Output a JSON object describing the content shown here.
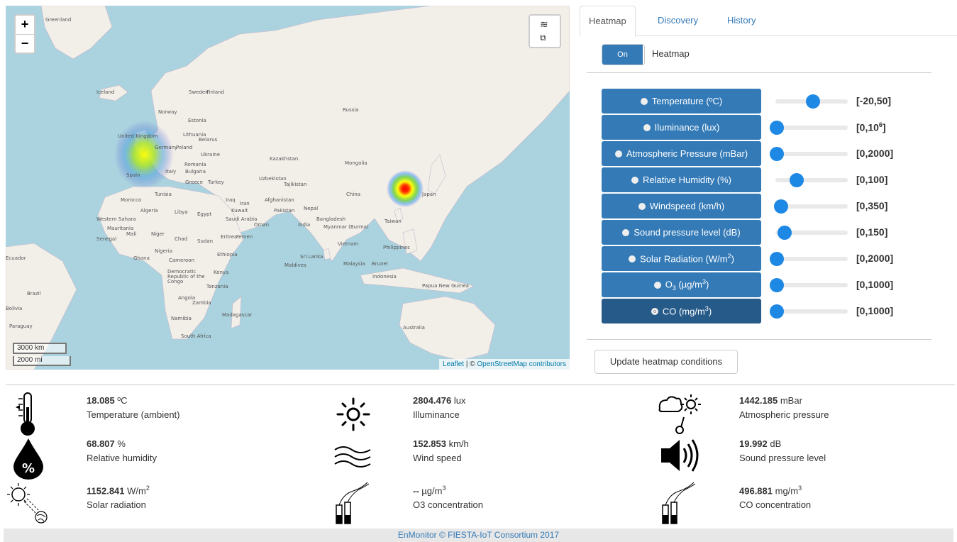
{
  "map": {
    "zoom_in": "+",
    "zoom_out": "−",
    "layers_icon": "layers-icon",
    "scale_km": "3000 km",
    "scale_mi": "2000 mi",
    "attribution_leaflet": "Leaflet",
    "attribution_sep": " | © ",
    "attribution_osm": "OpenStreetMap contributors",
    "labels": [
      "Greenland",
      "Iceland",
      "Sweden",
      "Finland",
      "Norway",
      "Estonia",
      "Lithuania",
      "Belarus",
      "Poland",
      "Germany",
      "Ukraine",
      "Romania",
      "Bulgaria",
      "Italy",
      "Spain",
      "Greece",
      "Turkey",
      "Tunisia",
      "Morocco",
      "Algeria",
      "Libya",
      "Egypt",
      "Western Sahara",
      "Mauritania",
      "Mali",
      "Niger",
      "Chad",
      "Sudan",
      "Senegal",
      "Nigeria",
      "Ghana",
      "Cameroon",
      "Ethiopia",
      "Eritrea",
      "Yemen",
      "Saudi Arabia",
      "Oman",
      "Iraq",
      "Iran",
      "Kuwait",
      "Afghanistan",
      "Pakistan",
      "India",
      "Nepal",
      "Bangladesh",
      "Myanmar (Burma)",
      "Sri Lanka",
      "Maldives",
      "Russia",
      "Kazakhstan",
      "Uzbekistan",
      "Tajikistan",
      "Mongolia",
      "China",
      "Japan",
      "Taiwan",
      "Philippines",
      "Vietnam",
      "Malaysia",
      "Brunei",
      "Indonesia",
      "Papua New Guinea",
      "Australia",
      "Tanzania",
      "Angola",
      "Zambia",
      "Namibia",
      "Madagascar",
      "South Africa",
      "Democratic Republic of the Congo",
      "Kenya",
      "Brazil",
      "Paraguay",
      "Bolivia",
      "Ecuador",
      "United Kingdom"
    ]
  },
  "tabs": [
    {
      "label": "Heatmap"
    },
    {
      "label": "Discovery"
    },
    {
      "label": "History"
    }
  ],
  "heatmap_toggle": {
    "state": "On",
    "label": "Heatmap"
  },
  "sensors": [
    {
      "name": "Temperature (ºC)",
      "range": "[-20,50]",
      "level": 0.55
    },
    {
      "name": "Iluminance (lux)",
      "range_main": "[0,10",
      "range_sup": "6",
      "range_end": "]",
      "level": 0.0
    },
    {
      "name": "Atmospheric Pressure (mBar)",
      "range": "[0,2000]",
      "level": 0.0
    },
    {
      "name": "Relative Humidity (%)",
      "range": "[0,100]",
      "level": 0.3
    },
    {
      "name": "Windspeed (km/h)",
      "range": "[0,350]",
      "level": 0.07
    },
    {
      "name_main": "Sound pressure level (dB)",
      "range": "[0,150]",
      "level": 0.12
    },
    {
      "name_main": "Solar Radiation (W/m",
      "name_sup": "2",
      "name_end": ")",
      "range": "[0,2000]",
      "level": 0.0
    },
    {
      "name_main": "O",
      "name_sub": "3",
      "name_mid": " (µg/m",
      "name_sup": "3",
      "name_end": ")",
      "range": "[0,1000]",
      "level": 0.0
    },
    {
      "name_main": "CO (mg/m",
      "name_sup": "3",
      "name_end": ")",
      "range": "[0,1000]",
      "level": 0.0
    }
  ],
  "update_button": "Update heatmap conditions",
  "readings": [
    {
      "value": "18.085",
      "unit": " ºC",
      "label": "Temperature (ambient)",
      "icon": "thermometer-icon"
    },
    {
      "value": "2804.476",
      "unit": " lux",
      "label": "Illuminance",
      "icon": "sun-icon"
    },
    {
      "value": "1442.185",
      "unit": " mBar",
      "label": "Atmospheric pressure",
      "icon": "barometer-icon"
    },
    {
      "value": "68.807",
      "unit": " %",
      "label": "Relative humidity",
      "icon": "humidity-drop-icon"
    },
    {
      "value": "152.853",
      "unit": " km/h",
      "label": "Wind speed",
      "icon": "wind-icon"
    },
    {
      "value": "19.992",
      "unit": " dB",
      "label": "Sound pressure level",
      "icon": "speaker-icon"
    },
    {
      "value": "1152.841",
      "unit": " W/m",
      "unit_sup": "2",
      "label": "Solar radiation",
      "icon": "solar-radiation-icon"
    },
    {
      "value": "--",
      "unit": " µg/m",
      "unit_sup": "3",
      "label": "O3 concentration",
      "icon": "factory-chimney-icon"
    },
    {
      "value": "496.881",
      "unit": " mg/m",
      "unit_sup": "3",
      "label": "CO concentration",
      "icon": "factory-chimney-icon"
    }
  ],
  "footer": "EnMonitor © FIESTA-IoT Consortium 2017"
}
